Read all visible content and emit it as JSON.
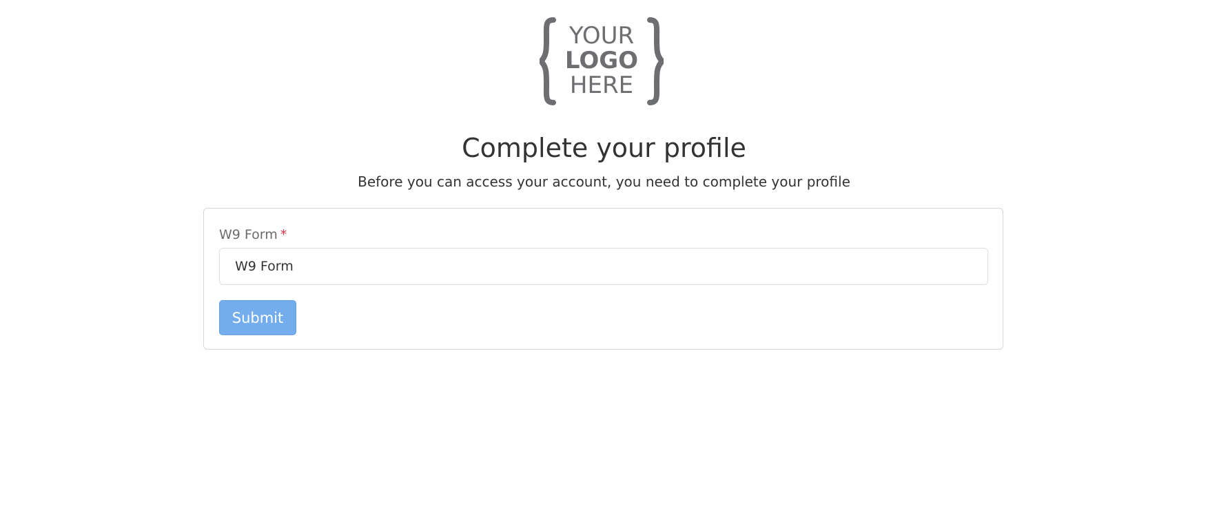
{
  "logo": {
    "line1": "YOUR",
    "line2": "LOGO",
    "line3": "HERE",
    "color": "#6d6e71"
  },
  "header": {
    "title": "Complete your profile",
    "subtitle": "Before you can access your account, you need to complete your profile"
  },
  "form": {
    "w9_label": "W9 Form",
    "required_marker": "*",
    "w9_value": "W9 Form",
    "submit_label": "Submit"
  },
  "colors": {
    "button_bg": "#73adee",
    "required": "#dc3545",
    "border": "#d6d6d6"
  }
}
